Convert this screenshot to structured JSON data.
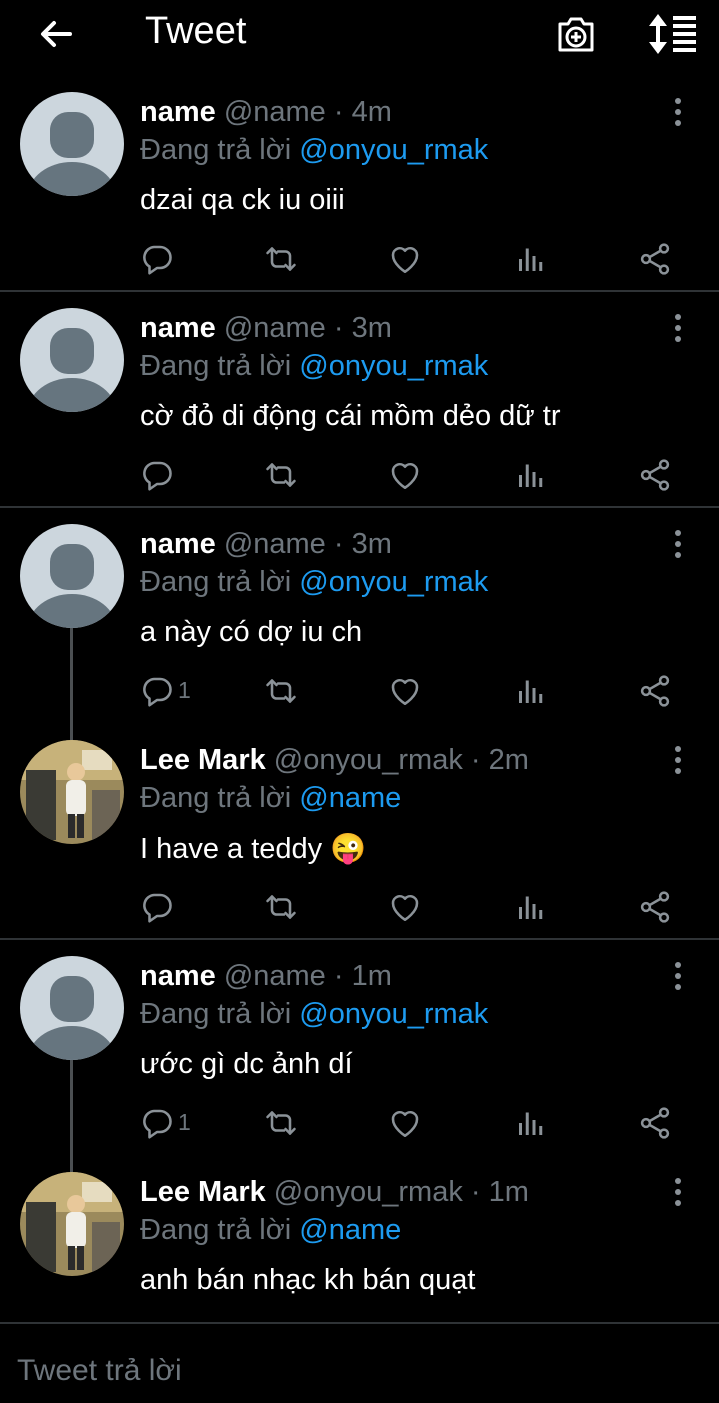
{
  "header": {
    "title": "Tweet"
  },
  "tweets": [
    {
      "name": "name",
      "handle": "@name",
      "sep": " · ",
      "time": "4m",
      "reply_prefix": "Đang trả lời ",
      "reply_to": "@onyou_rmak",
      "text": "dzai qa ck iu oiii",
      "reply_count": ""
    },
    {
      "name": "name",
      "handle": "@name",
      "sep": " · ",
      "time": "3m",
      "reply_prefix": "Đang trả lời ",
      "reply_to": "@onyou_rmak",
      "text": "cờ đỏ di động cái mồm dẻo dữ tr",
      "reply_count": ""
    },
    {
      "name": "name",
      "handle": "@name",
      "sep": " · ",
      "time": "3m",
      "reply_prefix": "Đang trả lời ",
      "reply_to": "@onyou_rmak",
      "text": "a này có dợ iu ch",
      "reply_count": "1"
    },
    {
      "name": "Lee Mark",
      "handle": "@onyou_rmak",
      "sep": " · ",
      "time": "2m",
      "reply_prefix": "Đang trả lời ",
      "reply_to": "@name",
      "text": "I have a teddy 😜",
      "reply_count": ""
    },
    {
      "name": "name",
      "handle": "@name",
      "sep": " · ",
      "time": "1m",
      "reply_prefix": "Đang trả lời ",
      "reply_to": "@onyou_rmak",
      "text": "ước gì dc ảnh dí",
      "reply_count": "1"
    },
    {
      "name": "Lee Mark",
      "handle": "@onyou_rmak",
      "sep": " · ",
      "time": "1m",
      "reply_prefix": "Đang trả lời ",
      "reply_to": "@name",
      "text": "anh bán nhạc kh bán quạt",
      "reply_count": ""
    }
  ],
  "compose": {
    "placeholder": "Tweet trả lời"
  },
  "colors": {
    "background": "#000000",
    "mention": "#1d9bf0",
    "secondary_text": "#6e767d",
    "divider": "#2f3336"
  }
}
